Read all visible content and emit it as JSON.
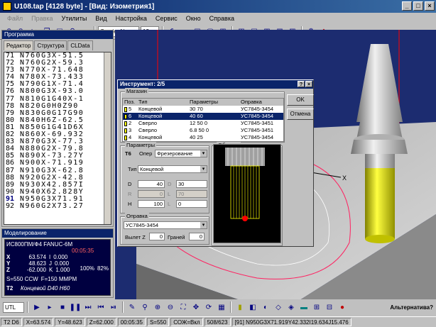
{
  "window": {
    "title": "U108.tap [4128 byte] - [Вид: Изометрия1]",
    "controls": [
      "_",
      "□",
      "×"
    ]
  },
  "menu": {
    "items": [
      {
        "label": "Файл",
        "disabled": true
      },
      {
        "label": "Правка",
        "disabled": true
      },
      {
        "label": "Утилиты",
        "disabled": false
      },
      {
        "label": "Вид",
        "disabled": false
      },
      {
        "label": "Настройка",
        "disabled": false
      },
      {
        "label": "Сервис",
        "disabled": false
      },
      {
        "label": "Окно",
        "disabled": false
      },
      {
        "label": "Справка",
        "disabled": false
      }
    ]
  },
  "toolbar": {
    "font_name": "Courier New",
    "font_size": "12"
  },
  "program_panel": {
    "title": "Программа",
    "tabs": [
      "Редактор",
      "Структура",
      "CLData"
    ],
    "lines": [
      {
        "n": "71",
        "code": "N760G3X-51.5"
      },
      {
        "n": "72",
        "code": "N760G2X-59.3"
      },
      {
        "n": "73",
        "code": "N770X-71.648"
      },
      {
        "n": "74",
        "code": "N780X-73.433"
      },
      {
        "n": "75",
        "code": "N790G1X-71.4"
      },
      {
        "n": "76",
        "code": "N800G3X-93.0"
      },
      {
        "n": "77",
        "code": "N810G1G40X-1"
      },
      {
        "n": "78",
        "code": "N820G0H0Z90"
      },
      {
        "n": "79",
        "code": "N830G0G17G90"
      },
      {
        "n": "80",
        "code": "N840H6Z-62.5"
      },
      {
        "n": "81",
        "code": "N850G1G41D6X"
      },
      {
        "n": "82",
        "code": "N860X-69.932"
      },
      {
        "n": "83",
        "code": "N870G3X-77.3"
      },
      {
        "n": "84",
        "code": "N880G2X-79.8"
      },
      {
        "n": "85",
        "code": "N890X-73.27Y"
      },
      {
        "n": "86",
        "code": "N900X-71.919"
      },
      {
        "n": "87",
        "code": "N910G3X-62.8"
      },
      {
        "n": "88",
        "code": "N920G2X-42.8"
      },
      {
        "n": "89",
        "code": "N930X42.857I"
      },
      {
        "n": "90",
        "code": "N940X62.828Y"
      },
      {
        "n": "91",
        "code": "N950G3X71.91"
      },
      {
        "n": "92",
        "code": "N960G2X73.27"
      }
    ]
  },
  "model_panel": {
    "title": "Моделирование",
    "controller": "ИС800ПМ/Ф4 FANUC-6M",
    "time": "00:05:35",
    "axes": [
      {
        "axis": "X",
        "value": "63.574",
        "suffix": "I",
        "extra": "0.000"
      },
      {
        "axis": "Y",
        "value": "48.623",
        "suffix": "J",
        "extra": "0.000"
      },
      {
        "axis": "Z",
        "value": "-62.000",
        "suffix": "K",
        "extra": "1.000"
      }
    ],
    "spindle": "S=550 CCW",
    "feed": "F=150 MMPM",
    "feed_override": "100%",
    "spindle_override": "82%",
    "tool_no": "T2",
    "tool_desc": "Концевой D40 H60"
  },
  "dialog": {
    "title": "Инструмент: 2/5",
    "magazine_label": "Магазин",
    "columns": [
      "Поз.",
      "Тип",
      "Параметры",
      "Оправка"
    ],
    "rows": [
      {
        "pos": "5",
        "type": "Концевой",
        "params": "30 70",
        "holder": "УС7845-3454",
        "selected": false
      },
      {
        "pos": "6",
        "type": "Концевой",
        "params": "40 60",
        "holder": "УС7845-3454",
        "selected": true
      },
      {
        "pos": "2",
        "type": "Сверло",
        "params": "12 50 0",
        "holder": "УС7845-3451",
        "selected": false
      },
      {
        "pos": "3",
        "type": "Сверло",
        "params": "6.8 50 0",
        "holder": "УС7845-3451",
        "selected": false
      },
      {
        "pos": "4",
        "type": "Концевой",
        "params": "40 25",
        "holder": "УС7845-3454",
        "selected": false
      }
    ],
    "ok_label": "OK",
    "cancel_label": "Отмена",
    "params_label": "Параметры",
    "tool_id": "T6",
    "oper_label": "Опер",
    "oper_value": "Фрезерование",
    "type_label": "Тип",
    "type_value": "Концевой",
    "fields": [
      {
        "label": "D",
        "value": "40",
        "label2": "D",
        "value2": "30",
        "gray": false
      },
      {
        "label": "R",
        "value": "0",
        "label2": "L",
        "value2": "70",
        "gray": true
      },
      {
        "label": "H",
        "value": "100",
        "label2": "L",
        "value2": "0",
        "gray": false
      }
    ],
    "sample_label": "Образец",
    "holder_label": "Оправка",
    "holder_value": "УС7845-3454",
    "overhang_label": "Вылет Z",
    "overhang_value": "0",
    "edges_label": "Граней",
    "edges_value": "0"
  },
  "bottombar": {
    "utl": "UTL",
    "alternative": "Альтернатива?"
  },
  "status": {
    "items": [
      "T2 D6",
      "X=63.574",
      "Y=48.623",
      "Z=62.000",
      "00:05:35",
      "S=550",
      "СОЖ=Вкл",
      "508/623",
      "[91] N950G3X71.919Y42.332I19.634J15.476"
    ]
  }
}
